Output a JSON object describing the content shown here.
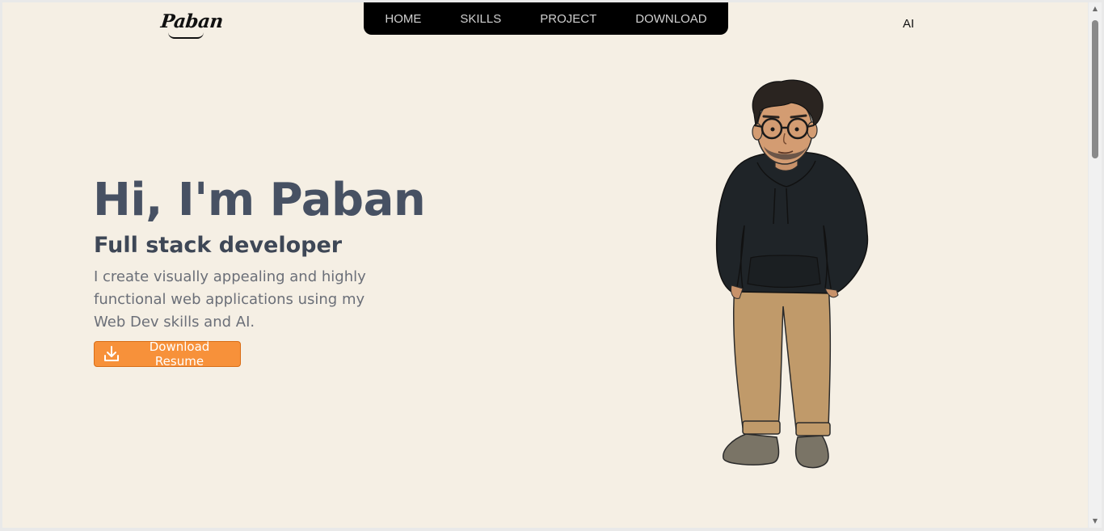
{
  "logo": {
    "text": "Paban"
  },
  "nav": {
    "items": [
      {
        "label": "HOME"
      },
      {
        "label": "SKILLS"
      },
      {
        "label": "PROJECT"
      },
      {
        "label": "DOWNLOAD"
      }
    ]
  },
  "ai_link": {
    "label": "AI"
  },
  "hero": {
    "title": "Hi, I'm Paban",
    "subtitle": "Full stack developer",
    "description": "I create visually appealing and highly functional web applications using my Web Dev skills and AI.",
    "button_label": "Download Resume",
    "button_icon": "download-icon"
  },
  "colors": {
    "page_bg": "#f5efe4",
    "nav_bg": "#000000",
    "title": "#475163",
    "accent": "#f7913a"
  }
}
